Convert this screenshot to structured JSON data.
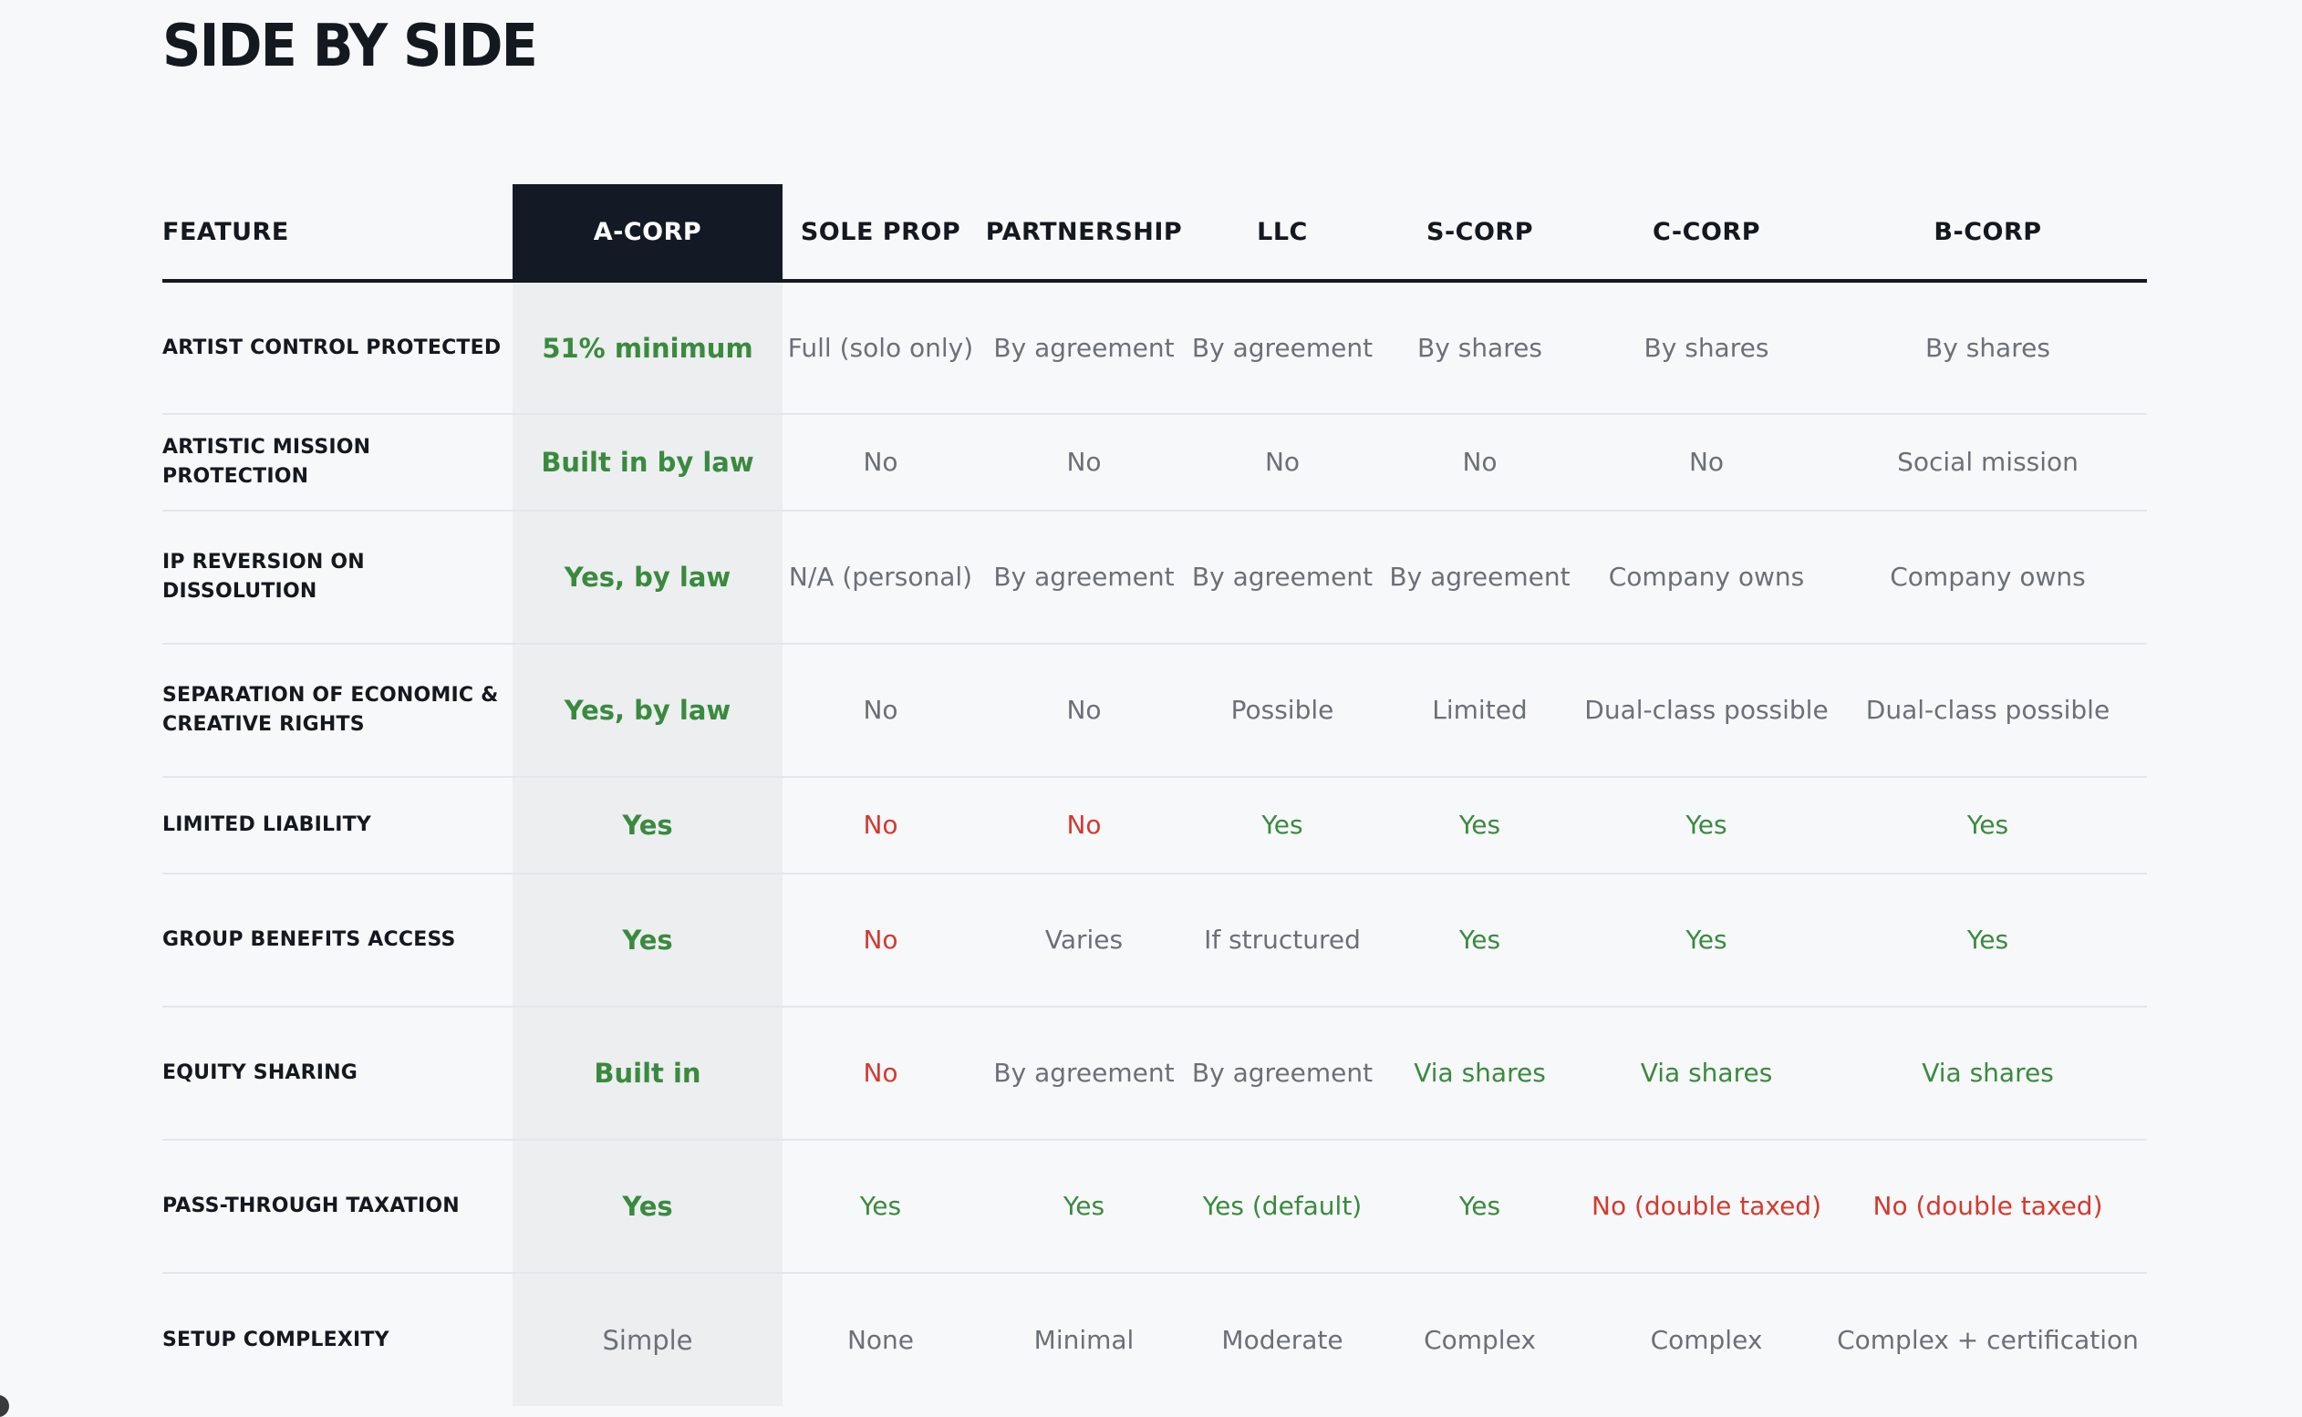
{
  "page_title": "SIDE BY SIDE",
  "headers": [
    "FEATURE",
    "A-CORP",
    "SOLE PROP",
    "PARTNERSHIP",
    "LLC",
    "S-CORP",
    "C-CORP",
    "B-CORP"
  ],
  "rows": [
    {
      "feature": "ARTIST CONTROL PROTECTED",
      "cells": [
        {
          "text": "51% minimum",
          "tone": "pos"
        },
        {
          "text": "Full (solo only)",
          "tone": "neu"
        },
        {
          "text": "By agreement",
          "tone": "neu"
        },
        {
          "text": "By agreement",
          "tone": "neu"
        },
        {
          "text": "By shares",
          "tone": "neu"
        },
        {
          "text": "By shares",
          "tone": "neu"
        },
        {
          "text": "By shares",
          "tone": "neu"
        }
      ],
      "height": 146
    },
    {
      "feature": "ARTISTIC MISSION PROTECTION",
      "cells": [
        {
          "text": "Built in by law",
          "tone": "pos"
        },
        {
          "text": "No",
          "tone": "neu"
        },
        {
          "text": "No",
          "tone": "neu"
        },
        {
          "text": "No",
          "tone": "neu"
        },
        {
          "text": "No",
          "tone": "neu"
        },
        {
          "text": "No",
          "tone": "neu"
        },
        {
          "text": "Social mission",
          "tone": "neu"
        }
      ],
      "height": 106
    },
    {
      "feature": "IP REVERSION ON DISSOLUTION",
      "cells": [
        {
          "text": "Yes, by law",
          "tone": "pos"
        },
        {
          "text": "N/A (personal)",
          "tone": "neu"
        },
        {
          "text": "By agreement",
          "tone": "neu"
        },
        {
          "text": "By agreement",
          "tone": "neu"
        },
        {
          "text": "By agreement",
          "tone": "neu"
        },
        {
          "text": "Company owns",
          "tone": "neu"
        },
        {
          "text": "Company owns",
          "tone": "neu"
        }
      ],
      "height": 146
    },
    {
      "feature": "SEPARATION OF ECONOMIC & CREATIVE RIGHTS",
      "cells": [
        {
          "text": "Yes, by law",
          "tone": "pos"
        },
        {
          "text": "No",
          "tone": "neu"
        },
        {
          "text": "No",
          "tone": "neu"
        },
        {
          "text": "Possible",
          "tone": "neu"
        },
        {
          "text": "Limited",
          "tone": "neu"
        },
        {
          "text": "Dual-class possible",
          "tone": "neu"
        },
        {
          "text": "Dual-class possible",
          "tone": "neu"
        }
      ],
      "height": 146
    },
    {
      "feature": "LIMITED LIABILITY",
      "cells": [
        {
          "text": "Yes",
          "tone": "pos"
        },
        {
          "text": "No",
          "tone": "neg"
        },
        {
          "text": "No",
          "tone": "neg"
        },
        {
          "text": "Yes",
          "tone": "pos"
        },
        {
          "text": "Yes",
          "tone": "pos"
        },
        {
          "text": "Yes",
          "tone": "pos"
        },
        {
          "text": "Yes",
          "tone": "pos"
        }
      ],
      "height": 106
    },
    {
      "feature": "GROUP BENEFITS ACCESS",
      "cells": [
        {
          "text": "Yes",
          "tone": "pos"
        },
        {
          "text": "No",
          "tone": "neg"
        },
        {
          "text": "Varies",
          "tone": "neu"
        },
        {
          "text": "If structured",
          "tone": "neu"
        },
        {
          "text": "Yes",
          "tone": "pos"
        },
        {
          "text": "Yes",
          "tone": "pos"
        },
        {
          "text": "Yes",
          "tone": "pos"
        }
      ],
      "height": 146
    },
    {
      "feature": "EQUITY SHARING",
      "cells": [
        {
          "text": "Built in",
          "tone": "pos"
        },
        {
          "text": "No",
          "tone": "neg"
        },
        {
          "text": "By agreement",
          "tone": "neu"
        },
        {
          "text": "By agreement",
          "tone": "neu"
        },
        {
          "text": "Via shares",
          "tone": "pos"
        },
        {
          "text": "Via shares",
          "tone": "pos"
        },
        {
          "text": "Via shares",
          "tone": "pos"
        }
      ],
      "height": 146
    },
    {
      "feature": "PASS-THROUGH TAXATION",
      "cells": [
        {
          "text": "Yes",
          "tone": "pos"
        },
        {
          "text": "Yes",
          "tone": "pos"
        },
        {
          "text": "Yes",
          "tone": "pos"
        },
        {
          "text": "Yes (default)",
          "tone": "pos"
        },
        {
          "text": "Yes",
          "tone": "pos"
        },
        {
          "text": "No (double taxed)",
          "tone": "neg"
        },
        {
          "text": "No (double taxed)",
          "tone": "neg"
        }
      ],
      "height": 146
    },
    {
      "feature": "SETUP COMPLEXITY",
      "cells": [
        {
          "text": "Simple",
          "tone": "neu"
        },
        {
          "text": "None",
          "tone": "neu"
        },
        {
          "text": "Minimal",
          "tone": "neu"
        },
        {
          "text": "Moderate",
          "tone": "neu"
        },
        {
          "text": "Complex",
          "tone": "neu"
        },
        {
          "text": "Complex",
          "tone": "neu"
        },
        {
          "text": "Complex + certification",
          "tone": "neu"
        }
      ],
      "height": 146
    }
  ],
  "colors": {
    "highlight_header_bg": "#131a26",
    "highlight_column_bg": "#eceef0",
    "positive": "#3a8a3e",
    "negative": "#d43a2f",
    "neutral": "#6b7078"
  }
}
